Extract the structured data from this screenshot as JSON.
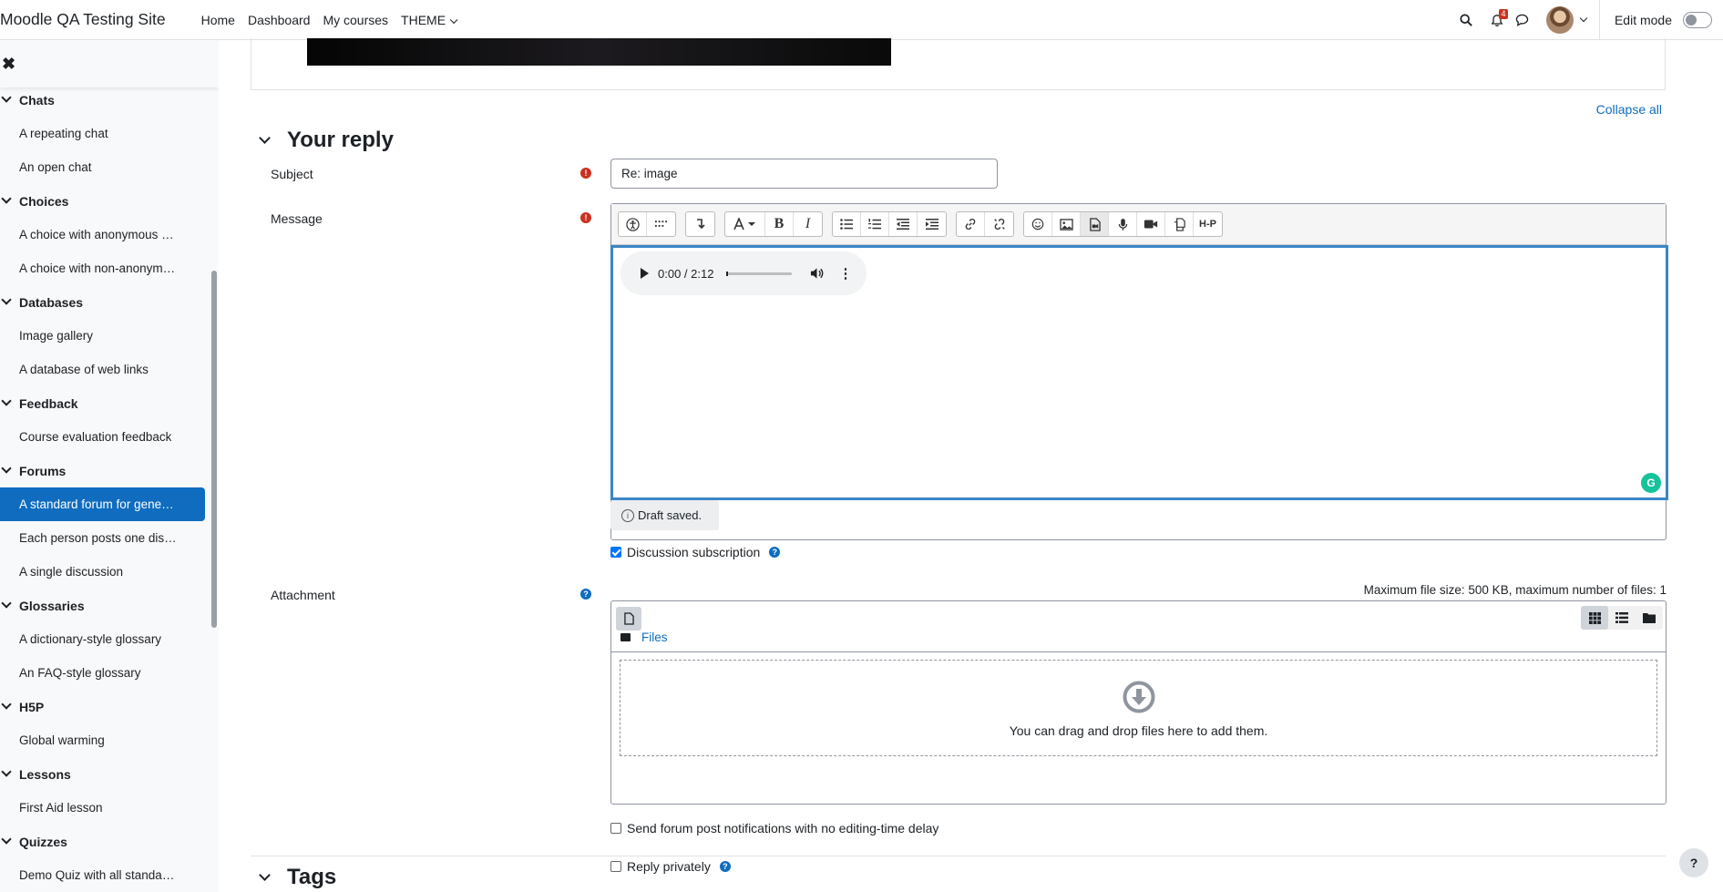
{
  "navbar": {
    "brand": "Moodle QA Testing Site",
    "links": [
      "Home",
      "Dashboard",
      "My courses",
      "THEME"
    ],
    "notification_count": "4",
    "edit_mode_label": "Edit mode"
  },
  "drawer": {
    "close_label": "✖",
    "sections": [
      {
        "title": "Chats",
        "items": [
          "A repeating chat",
          "An open chat"
        ]
      },
      {
        "title": "Choices",
        "items": [
          "A choice with anonymous …",
          "A choice with non-anonym…"
        ]
      },
      {
        "title": "Databases",
        "items": [
          "Image gallery",
          "A database of web links"
        ]
      },
      {
        "title": "Feedback",
        "items": [
          "Course evaluation feedback"
        ]
      },
      {
        "title": "Forums",
        "items": [
          "A standard forum for gene…",
          "Each person posts one dis…",
          "A single discussion"
        ]
      },
      {
        "title": "Glossaries",
        "items": [
          "A dictionary-style glossary",
          "An FAQ-style glossary"
        ]
      },
      {
        "title": "H5P",
        "items": [
          "Global warming"
        ]
      },
      {
        "title": "Lessons",
        "items": [
          "First Aid lesson"
        ]
      },
      {
        "title": "Quizzes",
        "items": [
          "Demo Quiz with all standa…"
        ]
      }
    ],
    "active_item": "A standard forum for gene…"
  },
  "form": {
    "collapse_all": "Collapse all",
    "section_title": "Your reply",
    "subject_label": "Subject",
    "subject_value": "Re: image",
    "message_label": "Message",
    "audio_time": "0:00 / 2:12",
    "audio_progress": 0.0,
    "draft_status": "Draft saved.",
    "discussion_subscription": "Discussion subscription",
    "discussion_subscription_checked": true,
    "attachment_label": "Attachment",
    "max_file_info": "Maximum file size: 500 KB, maximum number of files: 1",
    "files_path": "Files",
    "drop_text": "You can drag and drop files here to add them.",
    "no_delay_label": "Send forum post notifications with no editing-time delay",
    "no_delay_checked": false,
    "reply_privately_label": "Reply privately",
    "reply_privately_checked": false,
    "tags_title": "Tags",
    "help_button": "?"
  },
  "toolbar_icons": [
    "accessibility-checker-icon",
    "screenreader-helper-icon",
    "toggle-toolbar-icon",
    "font-style-icon",
    "bold-icon",
    "italic-icon",
    "unordered-list-icon",
    "ordered-list-icon",
    "outdent-icon",
    "indent-icon",
    "link-icon",
    "unlink-icon",
    "emoji-icon",
    "image-icon",
    "media-icon",
    "record-audio-icon",
    "record-video-icon",
    "manage-files-icon",
    "h5p-icon"
  ],
  "colors": {
    "primary": "#0f6cbf",
    "danger": "#ca3120",
    "editor_focus": "#3b86c7"
  }
}
